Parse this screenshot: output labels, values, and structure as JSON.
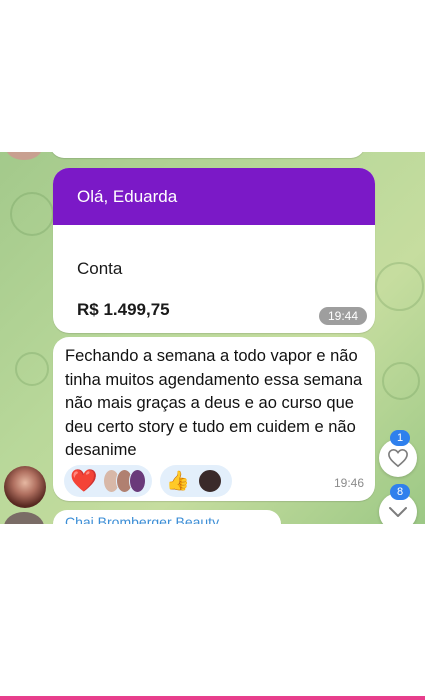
{
  "card": {
    "greeting": "Olá, Eduarda",
    "label": "Conta",
    "amount": "R$ 1.499,75",
    "time": "19:44",
    "header_color": "#7b19c7"
  },
  "message": {
    "text": "Fechando a semana a todo vapor e não tinha muitos agendamento essa semana não mais graças a deus e ao curso que deu certo story e tudo em cuidem e não desanime",
    "time": "19:46",
    "reactions": [
      {
        "emoji": "❤️",
        "icon": "red-heart-icon"
      },
      {
        "emoji": "👍",
        "icon": "thumbs-up-icon"
      }
    ]
  },
  "next_message": {
    "sender": "Chai Bromberger Beauty"
  },
  "side_buttons": {
    "reactions_badge": "1",
    "unread_badge": "8",
    "heart_icon": "heart-outline-icon",
    "down_icon": "chevron-down-icon"
  },
  "colors": {
    "chat_background": "#b9d89a",
    "accent_blue": "#2f80ed",
    "reaction_bg": "#e3effb"
  }
}
